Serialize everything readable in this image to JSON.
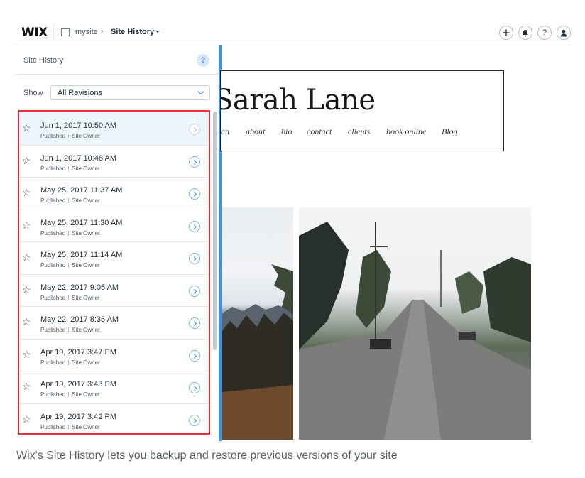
{
  "topbar": {
    "logo": "WIX",
    "site_name": "mysite",
    "breadcrumb_sep": "›",
    "current_page": "Site History",
    "icons": [
      "plus-icon",
      "bell-icon",
      "help-icon",
      "user-icon"
    ]
  },
  "panel": {
    "title": "Site History",
    "help_label": "?",
    "show_label": "Show",
    "filter_value": "All Revisions",
    "revisions": [
      {
        "date": "Jun 1, 2017 10:50 AM",
        "status": "Published",
        "author": "Site Owner"
      },
      {
        "date": "Jun 1, 2017 10:48 AM",
        "status": "Published",
        "author": "Site Owner"
      },
      {
        "date": "May 25, 2017 11:37 AM",
        "status": "Published",
        "author": "Site Owner"
      },
      {
        "date": "May 25, 2017 11:30 AM",
        "status": "Published",
        "author": "Site Owner"
      },
      {
        "date": "May 25, 2017 11:14 AM",
        "status": "Published",
        "author": "Site Owner"
      },
      {
        "date": "May 22, 2017 9:05 AM",
        "status": "Published",
        "author": "Site Owner"
      },
      {
        "date": "May 22, 2017 8:35 AM",
        "status": "Published",
        "author": "Site Owner"
      },
      {
        "date": "Apr 19, 2017 3:47 PM",
        "status": "Published",
        "author": "Site Owner"
      },
      {
        "date": "Apr 19, 2017 3:43 PM",
        "status": "Published",
        "author": "Site Owner"
      },
      {
        "date": "Apr 19, 2017 3:42 PM",
        "status": "Published",
        "author": "Site Owner"
      }
    ]
  },
  "preview": {
    "site_title": "Sarah Lane",
    "nav": [
      "an",
      "about",
      "bio",
      "contact",
      "clients",
      "book online",
      "Blog"
    ]
  },
  "caption": "Wix's Site History lets you backup and restore previous versions of your site",
  "colors": {
    "accent": "#3b93e8",
    "highlight": "#e53333",
    "selected_row": "#eef5fd"
  }
}
